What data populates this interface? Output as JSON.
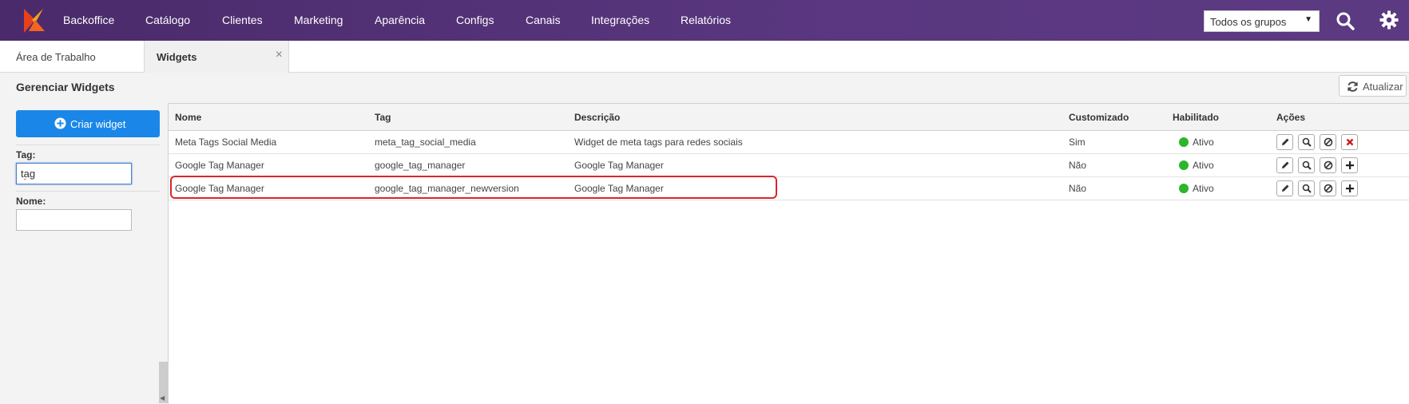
{
  "nav": {
    "items": [
      "Backoffice",
      "Catálogo",
      "Clientes",
      "Marketing",
      "Aparência",
      "Configs",
      "Canais",
      "Integrações",
      "Relatórios"
    ],
    "group_select": "Todos os grupos",
    "bg_color": "#553478"
  },
  "tabs": {
    "area": "Área de Trabalho",
    "widgets": "Widgets",
    "close": "×"
  },
  "page": {
    "title": "Gerenciar Widgets",
    "refresh_label": "Atualizar"
  },
  "sidebar": {
    "create_label": "Criar widget",
    "tag_label": "Tag:",
    "tag_value": "tag",
    "name_label": "Nome:",
    "name_value": ""
  },
  "table": {
    "headers": [
      "Nome",
      "Tag",
      "Descrição",
      "Customizado",
      "Habilitado",
      "Ações"
    ],
    "rows": [
      {
        "nome": "Meta Tags Social Media",
        "tag": "meta_tag_social_media",
        "descricao": "Widget de meta tags para redes sociais",
        "customizado": "Sim",
        "habilitado": "Ativo",
        "last_action": "remove"
      },
      {
        "nome": "Google Tag Manager",
        "tag": "google_tag_manager",
        "descricao": "Google Tag Manager",
        "customizado": "Não",
        "habilitado": "Ativo",
        "last_action": "add"
      },
      {
        "nome": "Google Tag Manager",
        "tag": "google_tag_manager_newversion",
        "descricao": "Google Tag Manager",
        "customizado": "Não",
        "habilitado": "Ativo",
        "last_action": "add"
      }
    ],
    "highlighted_row": 2
  },
  "colors": {
    "primary_button": "#1a87e8",
    "status_active": "#2db52d",
    "remove_icon": "#cc1f1f",
    "highlight_border": "#d9262a"
  }
}
